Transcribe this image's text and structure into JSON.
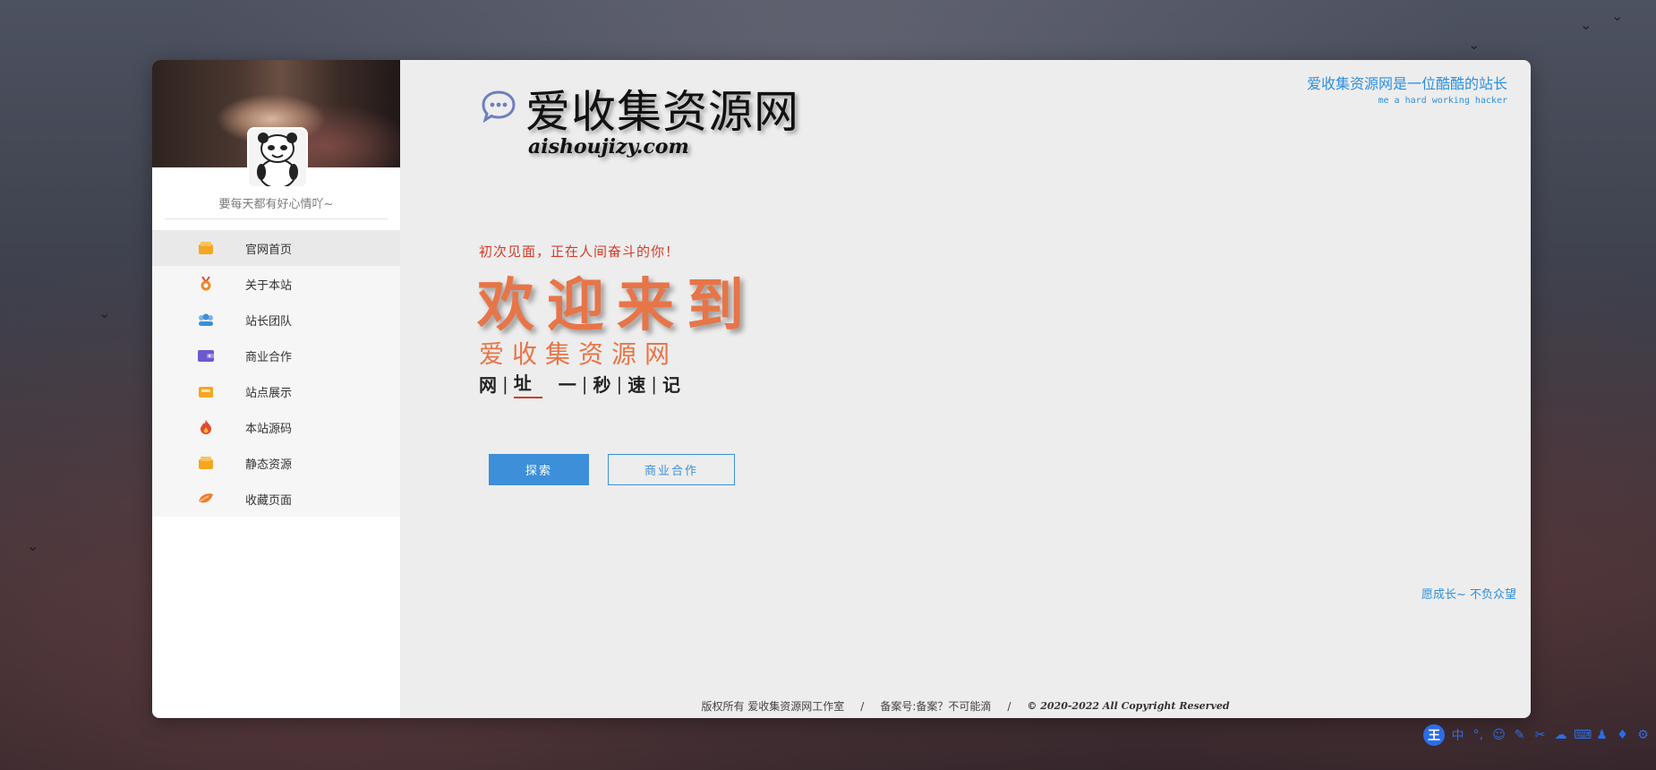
{
  "sidebar": {
    "motto": "要每天都有好心情吖~",
    "items": [
      {
        "label": "官网首页",
        "icon": "home-box-icon",
        "color": "#f5a623"
      },
      {
        "label": "关于本站",
        "icon": "medal-icon",
        "color": "#f08a24"
      },
      {
        "label": "站长团队",
        "icon": "team-icon",
        "color": "#3d8fd9"
      },
      {
        "label": "商业合作",
        "icon": "wallet-icon",
        "color": "#6a5acd"
      },
      {
        "label": "站点展示",
        "icon": "display-box-icon",
        "color": "#f5a623"
      },
      {
        "label": "本站源码",
        "icon": "fire-icon",
        "color": "#e2492f"
      },
      {
        "label": "静态资源",
        "icon": "box-icon",
        "color": "#f5a623"
      },
      {
        "label": "收藏页面",
        "icon": "leaf-icon",
        "color": "#f07d2a"
      }
    ]
  },
  "header": {
    "title": "爱收集资源网",
    "domain": "aishoujizy.com",
    "tagline": "爱收集资源网是一位酷酷的站长",
    "tagline_en": "me a hard working hacker"
  },
  "hero": {
    "greeting": "初次见面，正在人间奋斗的你！",
    "welcome": "欢迎来到",
    "site_name": "爱收集资源网",
    "address": [
      "网",
      "址",
      "一",
      "秒",
      "速",
      "记"
    ]
  },
  "buttons": {
    "explore": "探索",
    "business": "商业合作"
  },
  "side_note": "愿成长~ 不负众望",
  "footer": {
    "rights": "版权所有 爱收集资源网工作室",
    "icp": "备案号:备案？不可能滴",
    "copyright": "© 2020-2022 All Copyright Reserved"
  },
  "ime": {
    "logo": "王",
    "mode": "中"
  },
  "colors": {
    "accent": "#3d8fd9",
    "hero_orange": "#e77548",
    "greeting_red": "#d43b2a"
  }
}
